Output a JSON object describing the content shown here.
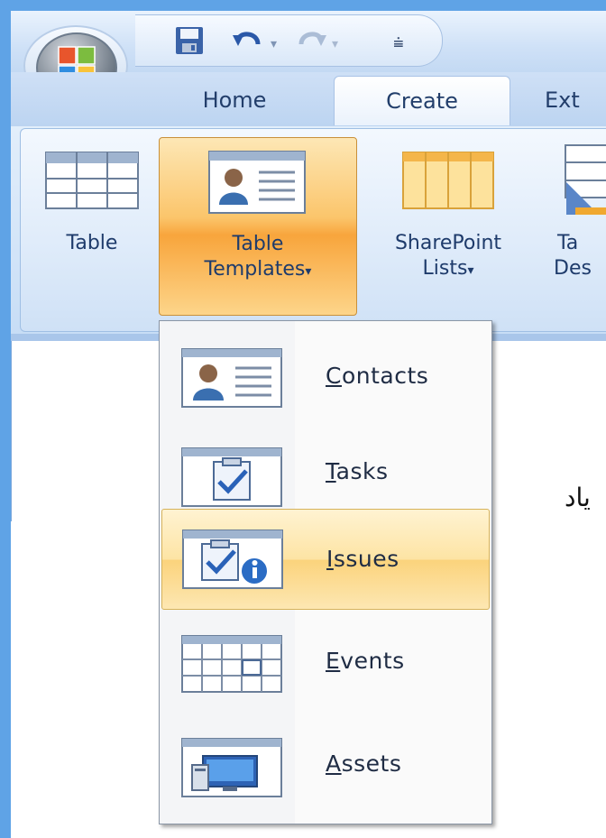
{
  "tabs": [
    "Home",
    "Create",
    "Ext"
  ],
  "active_tab": "Create",
  "ribbon": {
    "table": "Table",
    "table_templates_line1": "Table",
    "table_templates_line2": "Templates",
    "sharepoint_line1": "SharePoint",
    "sharepoint_line2": "Lists",
    "table_design_line1": "Ta",
    "table_design_line2": "Des",
    "dropdown_arrow": "▾"
  },
  "menu": {
    "items": [
      {
        "label": "Contacts",
        "accel": "C",
        "rest": "ontacts",
        "icon": "contacts-icon"
      },
      {
        "label": "Tasks",
        "accel": "T",
        "rest": "asks",
        "icon": "tasks-icon"
      },
      {
        "label": "Issues",
        "accel": "I",
        "rest": "ssues",
        "icon": "issues-icon",
        "highlighted": true
      },
      {
        "label": "Events",
        "accel": "E",
        "rest": "vents",
        "icon": "events-icon"
      },
      {
        "label": "Assets",
        "accel": "A",
        "rest": "ssets",
        "icon": "assets-icon"
      }
    ]
  },
  "document": {
    "text_fragment": "ياد"
  },
  "colors": {
    "accent": "#5fa3e6",
    "highlight": "#fbd37c",
    "text": "#1e3b6b"
  }
}
